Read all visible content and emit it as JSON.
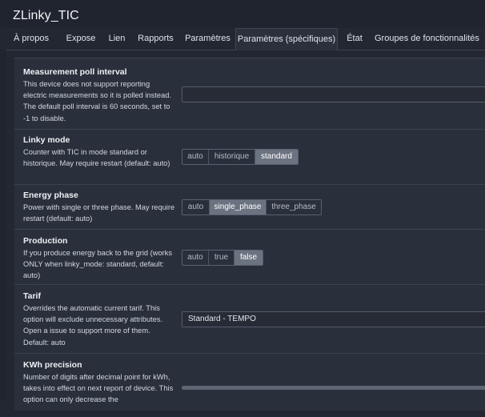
{
  "title": "ZLinky_TIC",
  "tabs": [
    {
      "label": "À propos"
    },
    {
      "label": "Expose"
    },
    {
      "label": "Lien"
    },
    {
      "label": "Rapports"
    },
    {
      "label": "Paramètres"
    },
    {
      "label": "Paramètres (spécifiques)",
      "active": true
    },
    {
      "label": "État"
    },
    {
      "label": "Groupes de fonctionnalités"
    }
  ],
  "settings": {
    "poll": {
      "title": "Measurement poll interval",
      "desc": "This device does not support reporting electric measurements so it is polled instead. The default poll interval is 60 seconds, set to -1 to disable.",
      "value": ""
    },
    "linky_mode": {
      "title": "Linky mode",
      "desc": "Counter with TIC in mode standard or historique. May require restart (default: auto)",
      "options": [
        "auto",
        "historique",
        "standard"
      ],
      "selected": "standard"
    },
    "energy_phase": {
      "title": "Energy phase",
      "desc": "Power with single or three phase. May require restart (default: auto)",
      "options": [
        "auto",
        "single_phase",
        "three_phase"
      ],
      "selected": "single_phase"
    },
    "production": {
      "title": "Production",
      "desc": "If you produce energy back to the grid (works ONLY when linky_mode: standard, default: auto)",
      "options": [
        "auto",
        "true",
        "false"
      ],
      "selected": "false"
    },
    "tarif": {
      "title": "Tarif",
      "desc": "Overrides the automatic current tarif. This option will exclude unnecessary attributes. Open a issue to support more of them. Default: auto",
      "value": "Standard - TEMPO"
    },
    "kwh": {
      "title": "KWh precision",
      "desc": "Number of digits after decimal point for kWh, takes into effect on next report of device. This option can only decrease the"
    }
  },
  "colors": {
    "background": "#222732",
    "panel": "#2a303b",
    "selected": "#6b7280"
  }
}
